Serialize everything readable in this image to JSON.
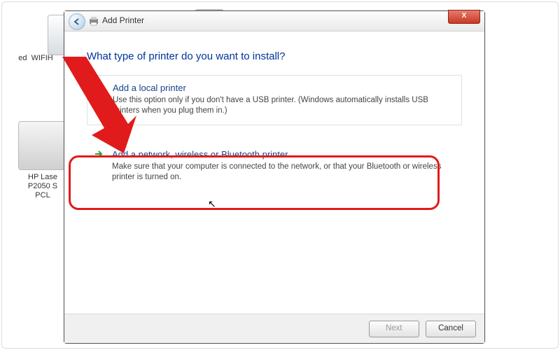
{
  "desktop": {
    "icon1_label": "WIFIH",
    "icon2_label": "ed",
    "printer_label": "HP Lase\nP2050 S\nPCL"
  },
  "dialog": {
    "title": "Add Printer",
    "heading": "What type of printer do you want to install?",
    "option_local": {
      "title": "Add a local printer",
      "desc": "Use this option only if you don't have a USB printer. (Windows automatically installs USB printers when you plug them in.)"
    },
    "option_network": {
      "title": "Add a network, wireless or Bluetooth printer",
      "desc": "Make sure that your computer is connected to the network, or that your Bluetooth or wireless printer is turned on."
    },
    "buttons": {
      "next": "Next",
      "cancel": "Cancel"
    },
    "close_glyph": "X"
  }
}
